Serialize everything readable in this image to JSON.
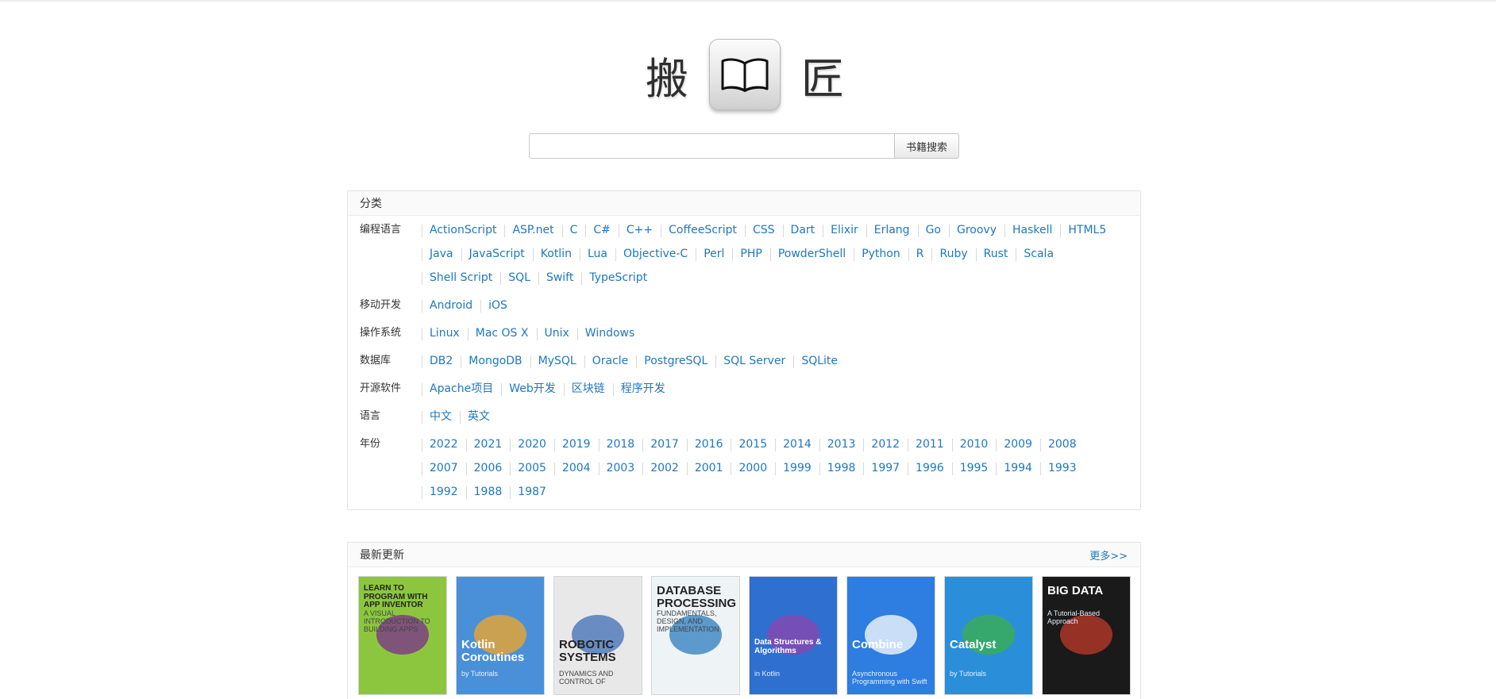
{
  "logo": {
    "left_char": "搬",
    "right_char": "匠",
    "icon": "open-book-icon"
  },
  "search": {
    "placeholder": "",
    "button_label": "书籍搜索"
  },
  "categories": {
    "title": "分类",
    "rows": [
      {
        "label": "编程语言",
        "links": [
          "ActionScript",
          "ASP.net",
          "C",
          "C#",
          "C++",
          "CoffeeScript",
          "CSS",
          "Dart",
          "Elixir",
          "Erlang",
          "Go",
          "Groovy",
          "Haskell",
          "HTML5",
          "Java",
          "JavaScript",
          "Kotlin",
          "Lua",
          "Objective-C",
          "Perl",
          "PHP",
          "PowderShell",
          "Python",
          "R",
          "Ruby",
          "Rust",
          "Scala",
          "Shell Script",
          "SQL",
          "Swift",
          "TypeScript"
        ]
      },
      {
        "label": "移动开发",
        "links": [
          "Android",
          "iOS"
        ]
      },
      {
        "label": "操作系统",
        "links": [
          "Linux",
          "Mac OS X",
          "Unix",
          "Windows"
        ]
      },
      {
        "label": "数据库",
        "links": [
          "DB2",
          "MongoDB",
          "MySQL",
          "Oracle",
          "PostgreSQL",
          "SQL Server",
          "SQLite"
        ]
      },
      {
        "label": "开源软件",
        "links": [
          "Apache项目",
          "Web开发",
          "区块链",
          "程序开发"
        ]
      },
      {
        "label": "语言",
        "links": [
          "中文",
          "英文"
        ]
      },
      {
        "label": "年份",
        "links": [
          "2022",
          "2021",
          "2020",
          "2019",
          "2018",
          "2017",
          "2016",
          "2015",
          "2014",
          "2013",
          "2012",
          "2011",
          "2010",
          "2009",
          "2008",
          "2007",
          "2006",
          "2005",
          "2004",
          "2003",
          "2002",
          "2001",
          "2000",
          "1999",
          "1998",
          "1997",
          "1996",
          "1995",
          "1994",
          "1993",
          "1992",
          "1988",
          "1987"
        ]
      }
    ]
  },
  "latest": {
    "title": "最新更新",
    "more_label": "更多>>",
    "books": [
      {
        "title": "LEARN TO PROGRAM WITH APP INVENTOR",
        "subtitle": "A VISUAL INTRODUCTION TO BUILDING APPS",
        "bg": "#8cc63f",
        "accent": "#7b2d8e"
      },
      {
        "title": "Kotlin Coroutines",
        "subtitle": "by Tutorials",
        "bg": "#4a90d9",
        "accent": "#f5a623"
      },
      {
        "title": "ROBOTIC SYSTEMS",
        "subtitle": "DYNAMICS AND CONTROL OF",
        "bg": "#e8e8e8",
        "accent": "#3f6db5"
      },
      {
        "title": "DATABASE PROCESSING",
        "subtitle": "FUNDAMENTALS, DESIGN, AND IMPLEMENTATION",
        "bg": "#eef3f6",
        "accent": "#2b7bbf"
      },
      {
        "title": "Data Structures & Algorithms",
        "subtitle": "in Kotlin",
        "bg": "#2f6fcf",
        "accent": "#8e44ad"
      },
      {
        "title": "Combine",
        "subtitle": "Asynchronous Programming with Swift",
        "bg": "#2e7de0",
        "accent": "#ffffff"
      },
      {
        "title": "Catalyst",
        "subtitle": "by Tutorials",
        "bg": "#2a8fd8",
        "accent": "#3cb04a"
      },
      {
        "title": "BIG DATA",
        "subtitle": "A Tutorial-Based Approach",
        "bg": "#1a1a1a",
        "accent": "#c0392b"
      }
    ]
  }
}
